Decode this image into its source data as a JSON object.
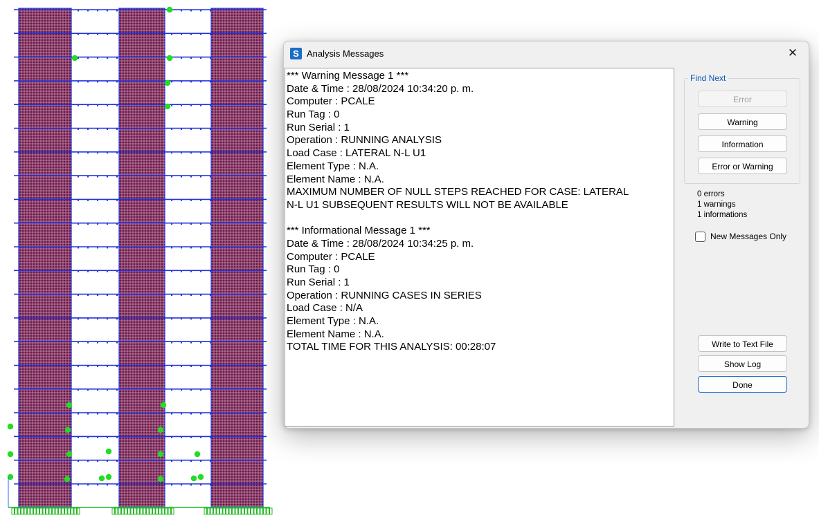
{
  "dialog": {
    "title": "Analysis Messages",
    "app_icon_letter": "S",
    "close_glyph": "✕"
  },
  "messages": [
    "*** Warning Message 1 ***",
    "Date & Time : 28/08/2024 10:34:20 p. m.",
    "Computer : PCALE",
    "Run Tag : 0",
    "Run Serial : 1",
    "Operation : RUNNING ANALYSIS",
    "Load Case : LATERAL N-L U1",
    "Element Type : N.A.",
    "Element Name : N.A.",
    "MAXIMUM NUMBER OF NULL STEPS REACHED FOR CASE: LATERAL",
    "N-L U1 SUBSEQUENT RESULTS WILL NOT BE AVAILABLE",
    "",
    "*** Informational Message 1 ***",
    "Date & Time : 28/08/2024 10:34:25 p. m.",
    "Computer : PCALE",
    "Run Tag : 0",
    "Run Serial : 1",
    "Operation : RUNNING CASES IN SERIES",
    "Load Case : N/A",
    "Element Type : N.A.",
    "Element Name : N.A.",
    "TOTAL TIME FOR THIS ANALYSIS: 00:28:07"
  ],
  "find_next": {
    "label": "Find Next",
    "error_button": "Error",
    "warning_button": "Warning",
    "information_button": "Information",
    "error_or_warning_button": "Error or Warning"
  },
  "counts": {
    "errors": "0 errors",
    "warnings": "1 warnings",
    "informations": "1 informations"
  },
  "new_messages_only": {
    "label": "New Messages Only",
    "checked": false
  },
  "actions": {
    "write_to_text_file": "Write to Text File",
    "show_log": "Show Log",
    "done": "Done"
  },
  "colors": {
    "shell_fill": "#6b1a4b",
    "mesh_line": "#f2c6d6",
    "frame_line": "#2233dd",
    "joint_node": "#22dd22",
    "support": "#22bb22",
    "accent": "#1a6dc7"
  }
}
